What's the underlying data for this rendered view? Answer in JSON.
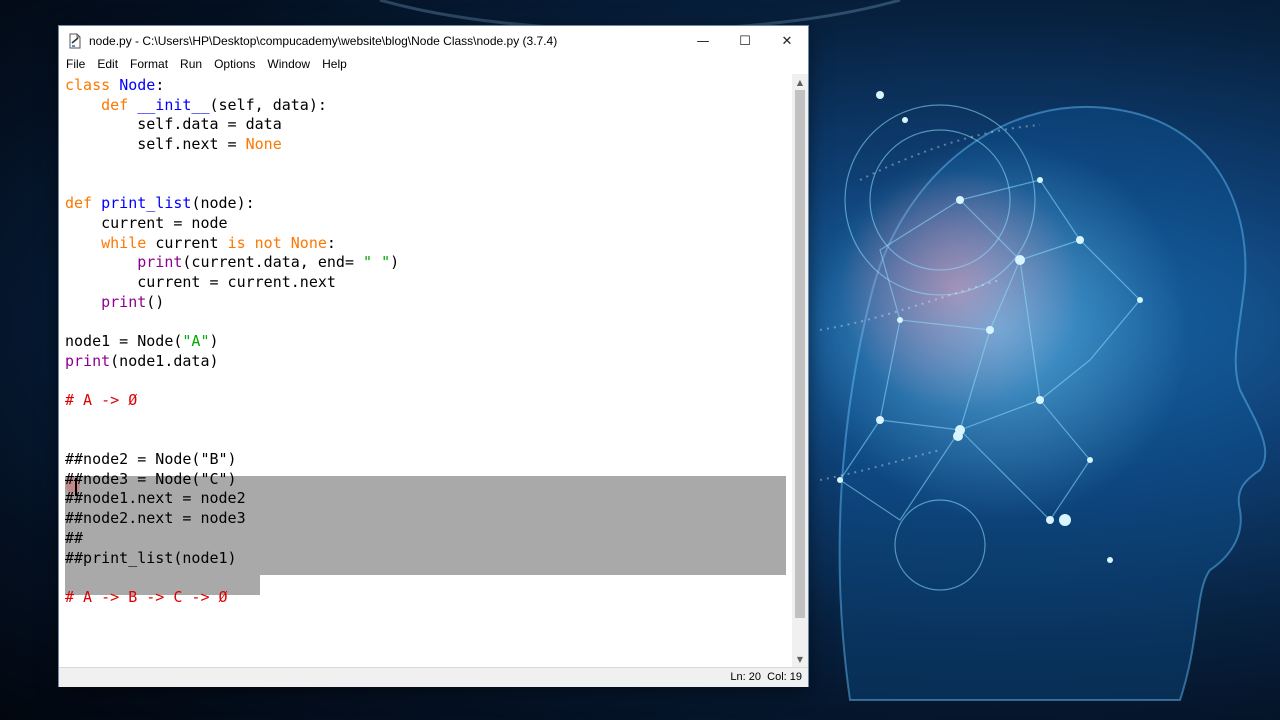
{
  "window": {
    "title": "node.py - C:\\Users\\HP\\Desktop\\compucademy\\website\\blog\\Node Class\\node.py (3.7.4)",
    "controls": {
      "minimize": "—",
      "maximize": "☐",
      "close": "✕"
    }
  },
  "menu": [
    "File",
    "Edit",
    "Format",
    "Run",
    "Options",
    "Window",
    "Help"
  ],
  "code_lines": [
    [
      {
        "t": "class ",
        "c": "kw"
      },
      {
        "t": "Node",
        "c": "def"
      },
      {
        "t": ":",
        "c": ""
      }
    ],
    [
      {
        "t": "    ",
        "c": ""
      },
      {
        "t": "def ",
        "c": "kw"
      },
      {
        "t": "__init__",
        "c": "def"
      },
      {
        "t": "(self, data):",
        "c": ""
      }
    ],
    [
      {
        "t": "        self.data = data",
        "c": ""
      }
    ],
    [
      {
        "t": "        self.next = ",
        "c": ""
      },
      {
        "t": "None",
        "c": "kw"
      }
    ],
    [],
    [],
    [
      {
        "t": "def ",
        "c": "kw"
      },
      {
        "t": "print_list",
        "c": "def"
      },
      {
        "t": "(node):",
        "c": ""
      }
    ],
    [
      {
        "t": "    current = node",
        "c": ""
      }
    ],
    [
      {
        "t": "    ",
        "c": ""
      },
      {
        "t": "while ",
        "c": "kw"
      },
      {
        "t": "current ",
        "c": ""
      },
      {
        "t": "is not None",
        "c": "kw"
      },
      {
        "t": ":",
        "c": ""
      }
    ],
    [
      {
        "t": "        ",
        "c": ""
      },
      {
        "t": "print",
        "c": "bi"
      },
      {
        "t": "(current.data, end= ",
        "c": ""
      },
      {
        "t": "\" \"",
        "c": "str"
      },
      {
        "t": ")",
        "c": ""
      }
    ],
    [
      {
        "t": "        current = current.next",
        "c": ""
      }
    ],
    [
      {
        "t": "    ",
        "c": ""
      },
      {
        "t": "print",
        "c": "bi"
      },
      {
        "t": "()",
        "c": ""
      }
    ],
    [],
    [
      {
        "t": "node1 = Node(",
        "c": ""
      },
      {
        "t": "\"A\"",
        "c": "str"
      },
      {
        "t": ")",
        "c": ""
      }
    ],
    [
      {
        "t": "print",
        "c": "bi"
      },
      {
        "t": "(node1.data)",
        "c": ""
      }
    ],
    [],
    [
      {
        "t": "# A -> Ø",
        "c": "cm"
      }
    ],
    [],
    [],
    [
      {
        "t": "##node2 = Node(\"B\")",
        "c": ""
      }
    ],
    [
      {
        "t": "##node3 = Node(\"C\")",
        "c": ""
      }
    ],
    [
      {
        "t": "##node1.next = node2",
        "c": ""
      }
    ],
    [
      {
        "t": "##node2.next = node3",
        "c": ""
      }
    ],
    [
      {
        "t": "##",
        "c": ""
      }
    ],
    [
      {
        "t": "##print_list(node1)",
        "c": ""
      }
    ],
    [],
    [
      {
        "t": "# A -> B -> C -> Ø",
        "c": "cm"
      }
    ]
  ],
  "status": {
    "line": "Ln: 20",
    "col": "Col: 19"
  },
  "colors": {
    "keyword": "#ff7700",
    "definition": "#0000ff",
    "builtin": "#900090",
    "string": "#00aa00",
    "comment": "#dd0000",
    "selection": "#a9a9a9"
  }
}
